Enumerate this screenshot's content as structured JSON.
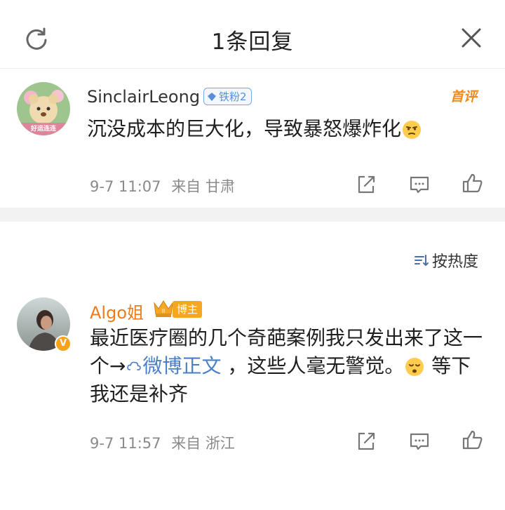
{
  "header": {
    "title": "1条回复",
    "refresh_icon": "refresh-icon",
    "close_icon": "close-icon"
  },
  "root_comment": {
    "username": "SinclairLeong",
    "fan_badge": "铁粉2",
    "tag": "首评",
    "content": "沉没成本的巨大化，导致暴怒爆炸化",
    "emoji": "thinking-face-emoji",
    "time": "9-7 11:07",
    "source": "来自 甘肃",
    "avatar_text": "好运连连"
  },
  "sort": {
    "label": "按热度",
    "icon": "sort-icon"
  },
  "reply": {
    "username": "Algo姐",
    "badge": "博主",
    "content_part1": "最近医疗圈的几个奇葩案例我只发出来了这一个→",
    "link_text": "微博正文",
    "content_part2": " ，这些人毫无警觉。",
    "emoji": "sad-face-emoji",
    "content_part3": " 等下我还是补齐",
    "time": "9-7 11:57",
    "source": "来自 浙江"
  },
  "actions": [
    "share-icon",
    "comment-icon",
    "like-icon"
  ],
  "colors": {
    "accent_orange": "#f07a1a",
    "link_blue": "#4a7fc8",
    "badge_blue": "#5b8fd8",
    "meta_gray": "#8a8a8a"
  }
}
